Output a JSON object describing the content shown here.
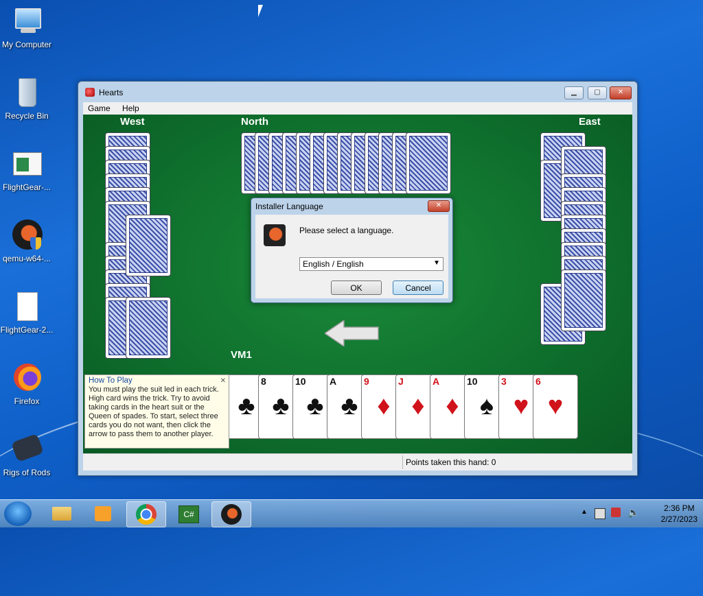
{
  "desktop": {
    "icons": [
      {
        "label": "My Computer",
        "icon": "computer-icon"
      },
      {
        "label": "Recycle Bin",
        "icon": "recycle-bin-icon"
      },
      {
        "label": "FlightGear-...",
        "icon": "app-window-icon"
      },
      {
        "label": "qemu-w64-...",
        "icon": "qemu-icon"
      },
      {
        "label": "FlightGear-2...",
        "icon": "file-icon"
      },
      {
        "label": "Firefox",
        "icon": "firefox-icon"
      },
      {
        "label": "Rigs of Rods",
        "icon": "rigs-of-rods-icon"
      }
    ]
  },
  "window": {
    "title": "Hearts",
    "menu": [
      "Game",
      "Help"
    ],
    "players": {
      "west": "West",
      "north": "North",
      "east": "East",
      "south": "VM1"
    },
    "status": "Points taken this hand: 0",
    "hand": [
      {
        "rank": "",
        "suit": "♣",
        "color": "#111111"
      },
      {
        "rank": "8",
        "suit": "♣",
        "color": "#111111"
      },
      {
        "rank": "10",
        "suit": "♣",
        "color": "#111111"
      },
      {
        "rank": "A",
        "suit": "♣",
        "color": "#111111"
      },
      {
        "rank": "9",
        "suit": "♦",
        "color": "#d0131b"
      },
      {
        "rank": "J",
        "suit": "♦",
        "color": "#d0131b"
      },
      {
        "rank": "A",
        "suit": "♦",
        "color": "#d0131b"
      },
      {
        "rank": "10",
        "suit": "♠",
        "color": "#111111"
      },
      {
        "rank": "3",
        "suit": "♥",
        "color": "#d0131b"
      },
      {
        "rank": "6",
        "suit": "♥",
        "color": "#d0131b"
      }
    ],
    "howto": {
      "heading": "How To Play",
      "text": "You must play the suit led in each trick. High card wins the trick. Try to avoid taking cards in the heart suit or the Queen of spades. To start, select three cards you do not want, then click the arrow to pass them to another player."
    }
  },
  "dialog": {
    "title": "Installer Language",
    "message": "Please select a language.",
    "selected_language": "English / English",
    "ok_label": "OK",
    "cancel_label": "Cancel"
  },
  "taskbar": {
    "time": "2:36 PM",
    "date": "2/27/2023",
    "apps": [
      "explorer-icon",
      "media-player-icon",
      "chrome-icon",
      "csharp-icon",
      "qemu-icon"
    ]
  }
}
